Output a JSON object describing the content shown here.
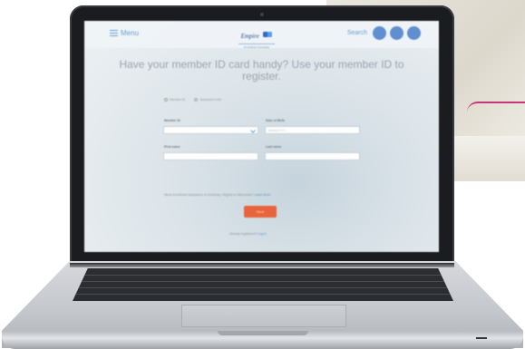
{
  "header": {
    "menu_label": "Menu",
    "logo_text": "Empire",
    "logo_subtext": "An Anthem Company",
    "search_label": "Search"
  },
  "main": {
    "headline": "Have your member ID card handy? Use your member ID to register.",
    "radio_options": [
      "Member ID",
      "Someone's info"
    ],
    "fields": {
      "member_id_label": "Member ID",
      "date_of_birth_label": "Date of Birth",
      "date_of_birth_placeholder": "MM/DD/YYYY",
      "first_name_label": "First name",
      "last_name_label": "Last name"
    },
    "help_text": "Need enrollment assistance in Kentucky, Virginia or Wisconsin?",
    "help_link": "Learn More",
    "next_button": "Next",
    "already_text": "Already registered?",
    "already_link": "Log in"
  },
  "colors": {
    "accent_blue": "#5f8fd0",
    "button_orange": "#e8643c"
  }
}
